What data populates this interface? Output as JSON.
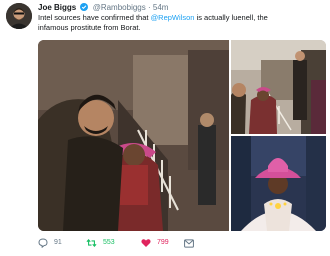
{
  "tweet": {
    "display_name": "Joe Biggs",
    "handle": "@Rambobiggs",
    "separator": "·",
    "timestamp": "54m",
    "text_part1": "Intel sources have confirmed that ",
    "mention": "@RepWilson",
    "text_part2": " is actually luenell, the",
    "text_line2": "infamous prostitute from Borat.",
    "reply_count": "91",
    "retweet_count": "553",
    "like_count": "799"
  },
  "colors": {
    "link": "#1da1f2",
    "retweet_active": "#17bf63",
    "like_active": "#e0245e",
    "muted": "#657786"
  },
  "icons": {
    "verified": "verified-badge-icon",
    "reply": "reply-icon",
    "retweet": "retweet-icon",
    "like": "heart-icon",
    "dm": "direct-message-icon"
  }
}
